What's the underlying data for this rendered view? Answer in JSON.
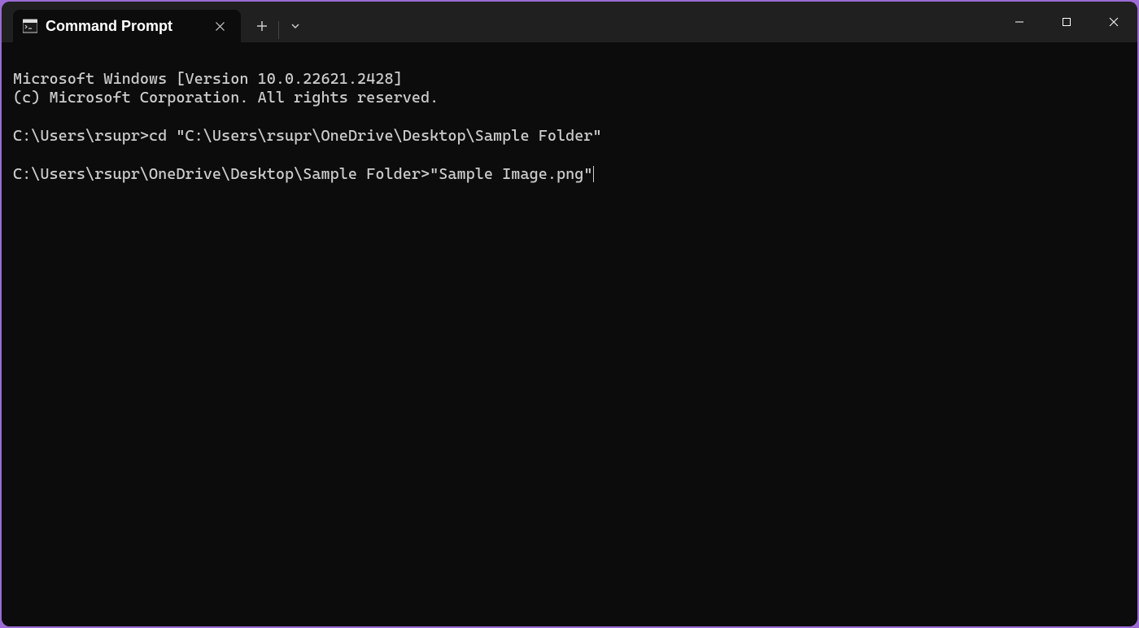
{
  "titlebar": {
    "tab_title": "Command Prompt"
  },
  "terminal": {
    "line1": "Microsoft Windows [Version 10.0.22621.2428]",
    "line2": "(c) Microsoft Corporation. All rights reserved.",
    "blank1": "",
    "line3": "C:\\Users\\rsupr>cd \"C:\\Users\\rsupr\\OneDrive\\Desktop\\Sample Folder\"",
    "blank2": "",
    "line4_prompt": "C:\\Users\\rsupr\\OneDrive\\Desktop\\Sample Folder>",
    "line4_input": "\"Sample Image.png\""
  }
}
